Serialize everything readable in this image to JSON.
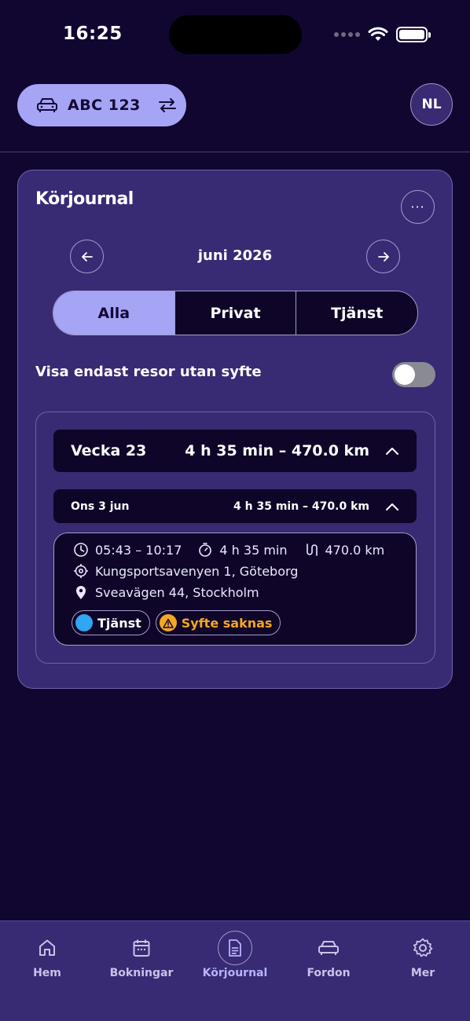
{
  "status_bar": {
    "time": "16:25"
  },
  "header": {
    "vehicle_plate": "ABC 123",
    "avatar_initials": "NL"
  },
  "journal": {
    "title": "Körjournal",
    "month": "juni 2026",
    "filters": [
      {
        "label": "Alla",
        "active": true
      },
      {
        "label": "Privat",
        "active": false
      },
      {
        "label": "Tjänst",
        "active": false
      }
    ],
    "toggle_label": "Visa endast resor utan syfte",
    "toggle_on": false,
    "week": {
      "title": "Vecka 23",
      "summary": "4 h 35 min – 470.0 km",
      "day": {
        "title": "Ons 3 jun",
        "summary": "4 h 35 min – 470.0 km",
        "trip": {
          "time_range": "05:43 – 10:17",
          "duration": "4 h 35 min",
          "distance": "470.0 km",
          "from": "Kungsportsavenyen 1, Göteborg",
          "to": "Sveavägen 44, Stockholm",
          "type_badge": "Tjänst",
          "warning_badge": "Syfte saknas"
        }
      }
    }
  },
  "tabbar": {
    "items": [
      {
        "label": "Hem",
        "icon": "home-icon"
      },
      {
        "label": "Bokningar",
        "icon": "calendar-icon"
      },
      {
        "label": "Körjournal",
        "icon": "document-icon",
        "active": true
      },
      {
        "label": "Fordon",
        "icon": "car-icon"
      },
      {
        "label": "Mer",
        "icon": "gear-icon"
      }
    ]
  },
  "colors": {
    "background": "#110630",
    "card": "#382a73",
    "accent": "#a6a4f5",
    "service_badge": "#2fa7f2",
    "warning": "#f5a623"
  }
}
